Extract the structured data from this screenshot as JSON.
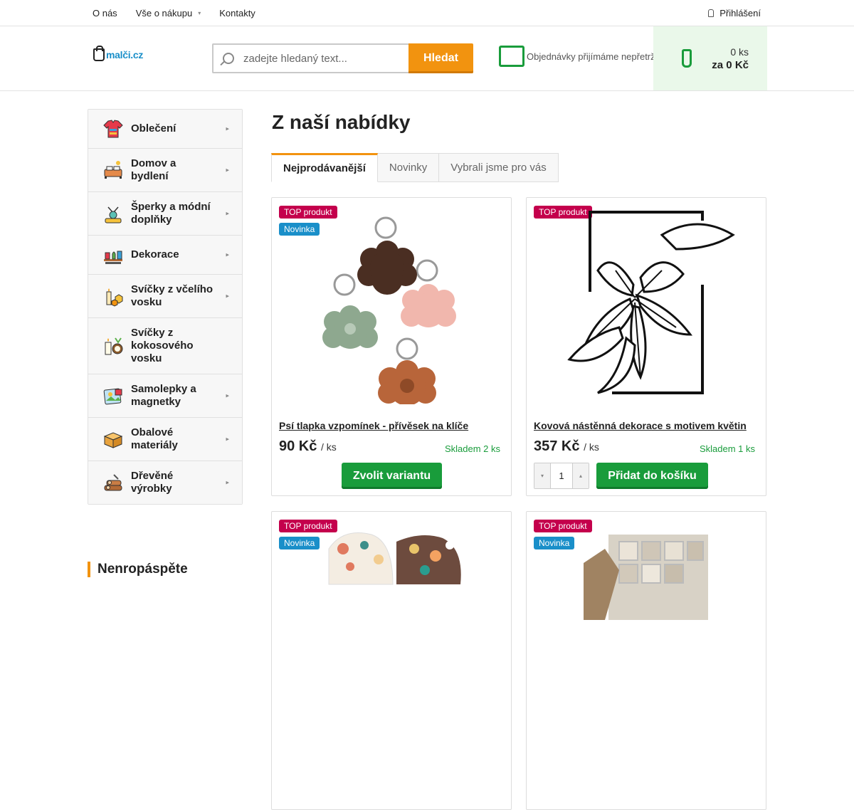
{
  "topnav": {
    "about": "O nás",
    "shopping": "Vše o nákupu",
    "shopping_chevron": "▾",
    "contacts": "Kontakty",
    "login": "Přihlášení"
  },
  "header": {
    "logo_text": "malči.cz",
    "search_placeholder": "zadejte hledaný text...",
    "search_button": "Hledat",
    "orders_note": "Objednávky přijímáme nepřetržitě",
    "cart_qty": "0 ks",
    "cart_sum": "za 0 Kč"
  },
  "sidebar": {
    "items": [
      {
        "label": "Oblečení",
        "icon": "clothing-icon",
        "arrow": "▸"
      },
      {
        "label": "Domov a bydlení",
        "icon": "home-icon",
        "arrow": "▸"
      },
      {
        "label": "Šperky a módní doplňky",
        "icon": "jewelry-icon",
        "arrow": "▸"
      },
      {
        "label": "Dekorace",
        "icon": "decoration-icon",
        "arrow": "▸"
      },
      {
        "label": "Svíčky z včelího vosku",
        "icon": "candle-icon",
        "arrow": "▸"
      },
      {
        "label": "Svíčky z kokosového vosku",
        "icon": "coconut-candle-icon",
        "arrow": ""
      },
      {
        "label": "Samolepky a magnetky",
        "icon": "sticker-icon",
        "arrow": "▸"
      },
      {
        "label": "Obalové materiály",
        "icon": "packaging-icon",
        "arrow": "▸"
      },
      {
        "label": "Dřevěné výrobky",
        "icon": "wood-icon",
        "arrow": "▸"
      }
    ],
    "aside_title": "Nenropáspěte"
  },
  "main": {
    "title": "Z naší nabídky",
    "tabs": [
      "Nejprodávanější",
      "Novinky",
      "Vybrali jsme pro vás"
    ]
  },
  "products": [
    {
      "name": "Psí tlapka vzpomínek - přívěsek na klíče",
      "price": "90 Kč",
      "unit": "/ ks",
      "stock": "Skladem 2 ks",
      "flags": [
        "TOP produkt",
        "Novinka"
      ],
      "button": "Zvolit variantu"
    },
    {
      "name": "Kovová nástěnná dekorace s motivem květin",
      "price": "357 Kč",
      "unit": "/ ks",
      "stock": "Skladem 1 ks",
      "flags": [
        "TOP produkt"
      ],
      "button": "Přidat do košíku",
      "qty": "1",
      "qty_minus": "▾",
      "qty_plus": "▴"
    },
    {
      "flags": [
        "TOP produkt",
        "Novinka"
      ]
    },
    {
      "flags": [
        "TOP produkt",
        "Novinka"
      ]
    }
  ],
  "colors": {
    "accent_orange": "#f2930f",
    "accent_green": "#199c3b",
    "flag_top": "#c4004c",
    "flag_new": "#1a8fc9"
  }
}
